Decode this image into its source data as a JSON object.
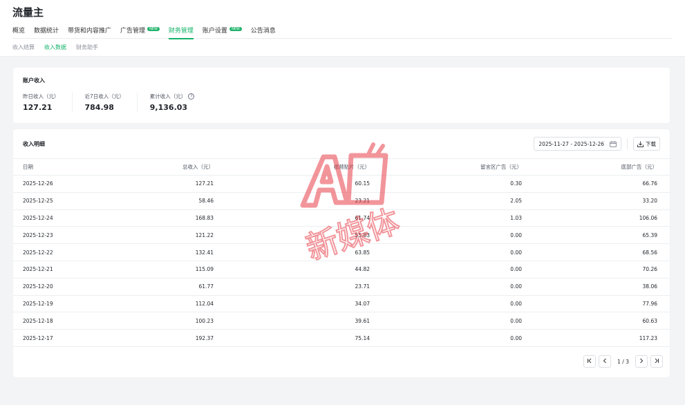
{
  "app": {
    "title": "流量主"
  },
  "nav": {
    "tabs": [
      {
        "label": "概览"
      },
      {
        "label": "数据统计"
      },
      {
        "label": "带货和内容推广"
      },
      {
        "label": "广告管理",
        "badge": "NEW"
      },
      {
        "label": "财务管理",
        "active": true
      },
      {
        "label": "账户设置",
        "badge": "NEW"
      },
      {
        "label": "公告消息"
      }
    ]
  },
  "sub_nav": {
    "tabs": [
      {
        "label": "收入结算"
      },
      {
        "label": "收入数据",
        "active": true
      },
      {
        "label": "财务助手"
      }
    ]
  },
  "income": {
    "title": "账户收入",
    "stats": [
      {
        "label": "昨日收入（元）",
        "value": "127.21"
      },
      {
        "label": "近7日收入（元）",
        "value": "784.98"
      },
      {
        "label": "累计收入（元）",
        "value": "9,136.03"
      }
    ]
  },
  "detail": {
    "title": "收入明细",
    "date_range": "2025-11-27 - 2025-12-26",
    "download_label": "下载",
    "columns": [
      "日期",
      "总收入（元）",
      "视频贴片（元）",
      "留言区广告（元）",
      "底部广告（元）"
    ],
    "rows": [
      [
        "2025-12-26",
        "127.21",
        "60.15",
        "0.30",
        "66.76"
      ],
      [
        "2025-12-25",
        "58.46",
        "23.21",
        "2.05",
        "33.20"
      ],
      [
        "2025-12-24",
        "168.83",
        "61.74",
        "1.03",
        "106.06"
      ],
      [
        "2025-12-23",
        "121.22",
        "55.83",
        "0.00",
        "65.39"
      ],
      [
        "2025-12-22",
        "132.41",
        "63.85",
        "0.00",
        "68.56"
      ],
      [
        "2025-12-21",
        "115.09",
        "44.82",
        "0.00",
        "70.26"
      ],
      [
        "2025-12-20",
        "61.77",
        "23.71",
        "0.00",
        "38.06"
      ],
      [
        "2025-12-19",
        "112.04",
        "34.07",
        "0.00",
        "77.96"
      ],
      [
        "2025-12-18",
        "100.23",
        "39.61",
        "0.00",
        "60.63"
      ],
      [
        "2025-12-17",
        "192.37",
        "75.14",
        "0.00",
        "117.23"
      ]
    ],
    "pagination": {
      "info": "1 / 3"
    }
  },
  "watermark": {
    "logo": "AI",
    "text": "新媒体",
    "color": "#e8404a"
  },
  "colors": {
    "accent": "#12b268",
    "badge": "#21b36b",
    "background": "#f3f4f6"
  }
}
